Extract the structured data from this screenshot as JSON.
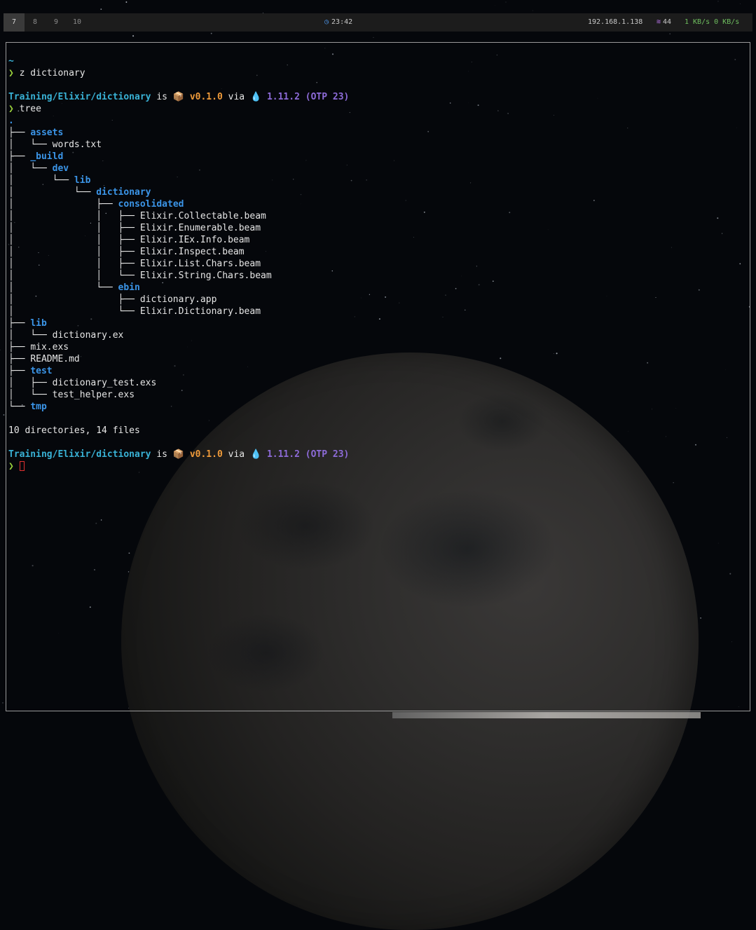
{
  "bar": {
    "workspaces": [
      {
        "label": "7",
        "active": true
      },
      {
        "label": "8",
        "active": false
      },
      {
        "label": "9",
        "active": false
      },
      {
        "label": "10",
        "active": false
      }
    ],
    "clock_icon": "clock-icon",
    "clock": "23:42",
    "ip": "192.168.1.138",
    "wifi_icon": "wifi-icon",
    "wifi_strength": "44",
    "net_speed": "1 KB/s 0 KB/s",
    "colors": {
      "bar_bg": "#1c1c1c",
      "active_ws": "#3a3a3a",
      "net": "#6fbf5f",
      "wifi_icon": "#b070e0",
      "clock_icon": "#4a90e2"
    }
  },
  "terminal": {
    "prompt_symbol": "❯",
    "home": "~",
    "cmd1": "z dictionary",
    "path": "Training/Elixir/dictionary",
    "is": "is",
    "pkg_icon": "📦",
    "version": "v0.1.0",
    "via": "via",
    "elixir_icon": "💧",
    "elixir_version": "1.11.2 (OTP 23)",
    "cmd2": "tree",
    "tree_root": ".",
    "tree": [
      {
        "prefix": "├── ",
        "name": "assets",
        "dir": true
      },
      {
        "prefix": "│   └── ",
        "name": "words.txt",
        "dir": false
      },
      {
        "prefix": "├── ",
        "name": "_build",
        "dir": true
      },
      {
        "prefix": "│   └── ",
        "name": "dev",
        "dir": true
      },
      {
        "prefix": "│       └── ",
        "name": "lib",
        "dir": true
      },
      {
        "prefix": "│           └── ",
        "name": "dictionary",
        "dir": true
      },
      {
        "prefix": "│               ├── ",
        "name": "consolidated",
        "dir": true
      },
      {
        "prefix": "│               │   ├── ",
        "name": "Elixir.Collectable.beam",
        "dir": false
      },
      {
        "prefix": "│               │   ├── ",
        "name": "Elixir.Enumerable.beam",
        "dir": false
      },
      {
        "prefix": "│               │   ├── ",
        "name": "Elixir.IEx.Info.beam",
        "dir": false
      },
      {
        "prefix": "│               │   ├── ",
        "name": "Elixir.Inspect.beam",
        "dir": false
      },
      {
        "prefix": "│               │   ├── ",
        "name": "Elixir.List.Chars.beam",
        "dir": false
      },
      {
        "prefix": "│               │   └── ",
        "name": "Elixir.String.Chars.beam",
        "dir": false
      },
      {
        "prefix": "│               └── ",
        "name": "ebin",
        "dir": true
      },
      {
        "prefix": "│                   ├── ",
        "name": "dictionary.app",
        "dir": false
      },
      {
        "prefix": "│                   └── ",
        "name": "Elixir.Dictionary.beam",
        "dir": false
      },
      {
        "prefix": "├── ",
        "name": "lib",
        "dir": true
      },
      {
        "prefix": "│   └── ",
        "name": "dictionary.ex",
        "dir": false
      },
      {
        "prefix": "├── ",
        "name": "mix.exs",
        "dir": false
      },
      {
        "prefix": "├── ",
        "name": "README.md",
        "dir": false
      },
      {
        "prefix": "├── ",
        "name": "test",
        "dir": true
      },
      {
        "prefix": "│   ├── ",
        "name": "dictionary_test.exs",
        "dir": false
      },
      {
        "prefix": "│   └── ",
        "name": "test_helper.exs",
        "dir": false
      },
      {
        "prefix": "└── ",
        "name": "tmp",
        "dir": true
      }
    ],
    "summary": "10 directories, 14 files",
    "colors": {
      "prompt": "#9ad13c",
      "path": "#39b2d6",
      "dir": "#3b95e8",
      "version": "#f09b3a",
      "elixir": "#8d6bd8",
      "cursor": "#e03030"
    }
  }
}
